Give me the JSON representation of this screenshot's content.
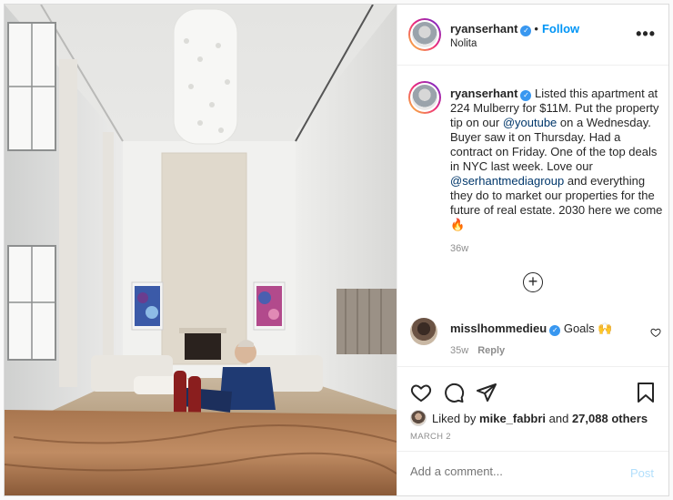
{
  "header": {
    "username": "ryanserhant",
    "follow_label": "Follow",
    "location": "Nolita",
    "more_label": "•••"
  },
  "caption": {
    "username": "ryanserhant",
    "text_1": " Listed this apartment at 224 Mulberry for $11M. Put the property tip on our ",
    "mention_1": "@youtube",
    "text_2": " on a Wednesday. Buyer saw it on Thursday. Had a contract on Friday. One of the top deals in NYC last week. Love our ",
    "mention_2": "@serhantmediagroup",
    "text_3": " and everything they do to market our properties for the future of real estate. 2030 here we come 🔥",
    "time_ago": "36w"
  },
  "load_more_label": "+",
  "comment": {
    "username": "misslhommedieu",
    "text": "Goals 🙌",
    "time_ago": "35w",
    "reply_label": "Reply"
  },
  "likes": {
    "prefix": "Liked by ",
    "user": "mike_fabbri",
    "middle": " and ",
    "others": "27,088 others"
  },
  "date": "MARCH 2",
  "add_comment": {
    "placeholder": "Add a comment...",
    "post_label": "Post"
  },
  "colors": {
    "accent": "#0095f6",
    "post_disabled": "#b2dffc",
    "mention": "#00376b",
    "muted": "#8e8e8e"
  }
}
